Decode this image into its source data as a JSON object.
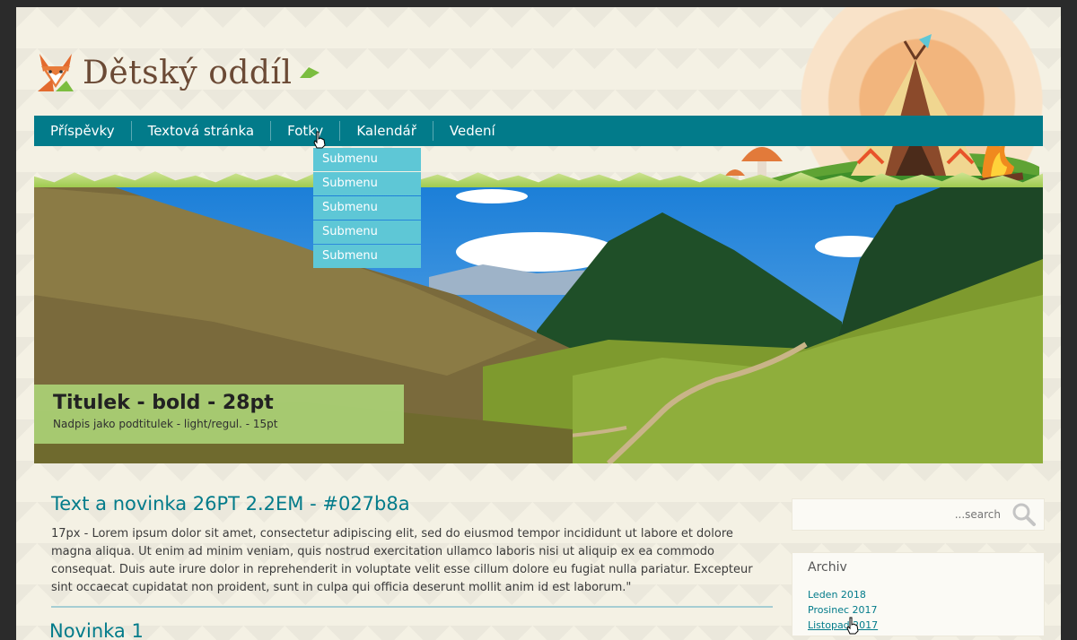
{
  "site": {
    "title": "Dětský oddíl"
  },
  "nav": {
    "items": [
      {
        "label": "Příspěvky"
      },
      {
        "label": "Textová stránka"
      },
      {
        "label": "Fotky"
      },
      {
        "label": "Kalendář"
      },
      {
        "label": "Vedení"
      }
    ]
  },
  "submenu": {
    "items": [
      {
        "label": "Submenu"
      },
      {
        "label": "Submenu"
      },
      {
        "label": "Submenu"
      },
      {
        "label": "Submenu"
      },
      {
        "label": "Submenu"
      }
    ]
  },
  "hero": {
    "title": "Titulek - bold - 28pt",
    "subtitle": "Nadpis jako podtitulek - light/regul. - 15pt"
  },
  "content": {
    "title": "Text a novinka 26PT 2.2EM - #027b8a",
    "text": "17px  - Lorem ipsum dolor sit amet, consectetur adipiscing elit, sed do eiusmod tempor incididunt ut labore et dolore magna aliqua. Ut enim ad minim veniam, quis nostrud exercitation ullamco laboris nisi ut aliquip ex ea commodo consequat. Duis aute irure dolor in reprehenderit in voluptate velit esse cillum dolore eu fugiat nulla pariatur. Excepteur sint occaecat cupidatat non proident, sunt in culpa qui officia deserunt mollit anim id est laborum.\"",
    "news_title": "Novinka 1"
  },
  "sidebar": {
    "search_placeholder": "...search",
    "archive_title": "Archiv",
    "archive_links": [
      {
        "label": "Leden 2018"
      },
      {
        "label": "Prosinec 2017"
      },
      {
        "label": "Listopad 2017"
      }
    ]
  },
  "colors": {
    "accent": "#027b8a",
    "submenu": "#5ec7d6",
    "caption": "#aad176",
    "logo": "#6b4a35"
  },
  "icons": {
    "logo": "fox-icon",
    "search": "search-icon",
    "tipi": "tipi-icon",
    "fire": "campfire-icon",
    "mushroom": "mushroom-icon",
    "cursor": "hand-cursor-icon"
  }
}
